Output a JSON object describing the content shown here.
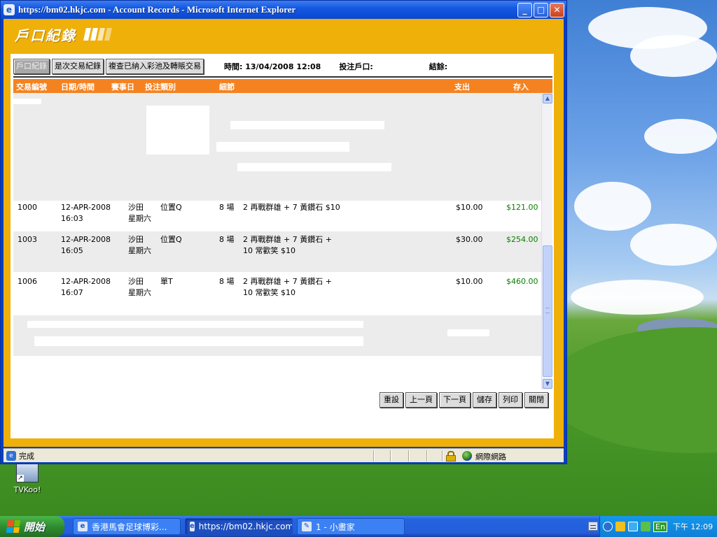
{
  "window": {
    "icon": "ie-icon",
    "title": "https://bm02.hkjc.com - Account Records - Microsoft Internet Explorer",
    "minimize": "_",
    "maximize": "□",
    "close": "✕"
  },
  "page": {
    "title": "戶口紀錄",
    "tabs": [
      {
        "label": "戶口紀錄",
        "active": true
      },
      {
        "label": "是次交易紀錄",
        "active": false
      },
      {
        "label": "複查已納入彩池及轉賬交易",
        "active": false
      }
    ],
    "time_label": "時間: 13/04/2008 12:08",
    "account_label": "投注戶口:",
    "balance_label": "結餘:"
  },
  "table": {
    "headers": [
      "交易編號",
      "日期/時間",
      "賽事日",
      "投注類別",
      "細節",
      "支出",
      "存入"
    ],
    "rows": [
      {
        "id": "1000",
        "date": "12-APR-2008",
        "time": "16:03",
        "venue": "沙田",
        "day": "星期六",
        "bet_type": "位置Q",
        "race": "8 場",
        "detail1": "2 再戰群雄 + 7 黃鑽石 $10",
        "detail2": "",
        "debit": "$10.00",
        "credit": "$121.00"
      },
      {
        "id": "1003",
        "date": "12-APR-2008",
        "time": "16:05",
        "venue": "沙田",
        "day": "星期六",
        "bet_type": "位置Q",
        "race": "8 場",
        "detail1": "2 再戰群雄 + 7 黃鑽石 +",
        "detail2": "10 常歡笑 $10",
        "debit": "$30.00",
        "credit": "$254.00"
      },
      {
        "id": "1006",
        "date": "12-APR-2008",
        "time": "16:07",
        "venue": "沙田",
        "day": "星期六",
        "bet_type": "單T",
        "race": "8 場",
        "detail1": "2 再戰群雄 + 7 黃鑽石 +",
        "detail2": "10 常歡笑 $10",
        "debit": "$10.00",
        "credit": "$460.00"
      }
    ]
  },
  "buttons": [
    "重設",
    "上一頁",
    "下一頁",
    "儲存",
    "列印",
    "關閉"
  ],
  "statusbar": {
    "status": "完成",
    "zone": "網際網路"
  },
  "desktop": {
    "icon_label": "TVKoo!"
  },
  "taskbar": {
    "start": "開始",
    "tasks": [
      {
        "label": "香港馬會足球博彩...",
        "active": false
      },
      {
        "label": "https://bm02.hkjc.com ...",
        "active": true
      },
      {
        "label": "1 - 小畫家",
        "active": false
      }
    ],
    "lang": "En",
    "clock": "下午 12:09"
  },
  "colors": {
    "window_frame": "#0a3fbf",
    "page_background": "#f0b00a",
    "table_header": "#f58220",
    "credit_text": "#0a7d00"
  }
}
